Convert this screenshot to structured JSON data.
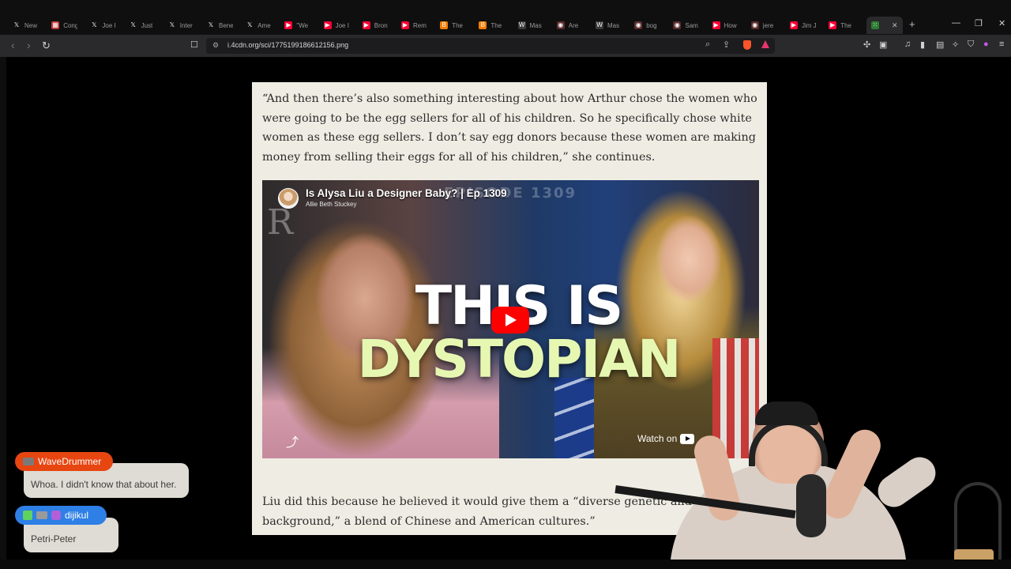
{
  "browser": {
    "tabs": [
      {
        "label": "New",
        "icon": "x-icon",
        "color": "#ffffff"
      },
      {
        "label": "Cong",
        "icon": "congress-icon",
        "color": "#c23b3b"
      },
      {
        "label": "Joe I",
        "icon": "x-icon",
        "color": "#ffffff"
      },
      {
        "label": "Just",
        "icon": "x-icon",
        "color": "#ffffff"
      },
      {
        "label": "Inter",
        "icon": "x-icon",
        "color": "#ffffff"
      },
      {
        "label": "Bene",
        "icon": "x-icon",
        "color": "#ffffff"
      },
      {
        "label": "Ame",
        "icon": "x-icon",
        "color": "#ffffff"
      },
      {
        "label": "\"We",
        "icon": "youtube-icon",
        "color": "#ff0033"
      },
      {
        "label": "Joe I",
        "icon": "youtube-icon",
        "color": "#ff0033"
      },
      {
        "label": "Bron",
        "icon": "youtube-icon",
        "color": "#ff0033"
      },
      {
        "label": "Rem",
        "icon": "youtube-icon",
        "color": "#ff0033"
      },
      {
        "label": "The",
        "icon": "blogger-icon",
        "color": "#f57c00"
      },
      {
        "label": "The",
        "icon": "blogger-icon",
        "color": "#f57c00"
      },
      {
        "label": "Mas",
        "icon": "wordpress-icon",
        "color": "#dcdcdc"
      },
      {
        "label": "Are",
        "icon": "site-icon",
        "color": "#8899cc"
      },
      {
        "label": "Mas",
        "icon": "wordpress-icon",
        "color": "#dcdcdc"
      },
      {
        "label": "bog",
        "icon": "site-icon",
        "color": "#e05a5a"
      },
      {
        "label": "Sam",
        "icon": "site-icon",
        "color": "#e05a5a"
      },
      {
        "label": "How",
        "icon": "youtube-icon",
        "color": "#ff0033"
      },
      {
        "label": "jere",
        "icon": "site-icon",
        "color": "#e05a5a"
      },
      {
        "label": "Jim J",
        "icon": "youtube-icon",
        "color": "#ff0033"
      },
      {
        "label": "The",
        "icon": "youtube-icon",
        "color": "#ff0033"
      }
    ],
    "active_tab_icon": "image-icon",
    "url": "i.4cdn.org/sci/1775199186612156.png",
    "accent": "#fb542b"
  },
  "article": {
    "para1": "“And then there’s also something interesting about how Arthur chose the women who were going to be the egg sellers for all of his children. So he specifically chose white women as these egg sellers. I don’t say egg donors because these women are making money from selling their eggs for all of his children,” she continues.",
    "para2": "Liu did this because he believed it would give them a “diverse genetic and cultural background,” a blend of Chinese and American cultures.”"
  },
  "video": {
    "title": "Is Alysa Liu a Designer Baby? | Ep 1309",
    "channel": "Allie Beth Stuckey",
    "ghost_episode": "EPISODE 1309",
    "headline_line1": "THIS IS",
    "headline_line2": "DYSTOPIAN",
    "watch_label": "Watch on"
  },
  "chat": [
    {
      "user": "WaveDrummer",
      "message": "Whoa. I didn't know that about her.",
      "name_color": "#e74611"
    },
    {
      "user": "dijikul",
      "message": "Petri-Peter",
      "name_color": "#2e7fe6"
    }
  ]
}
